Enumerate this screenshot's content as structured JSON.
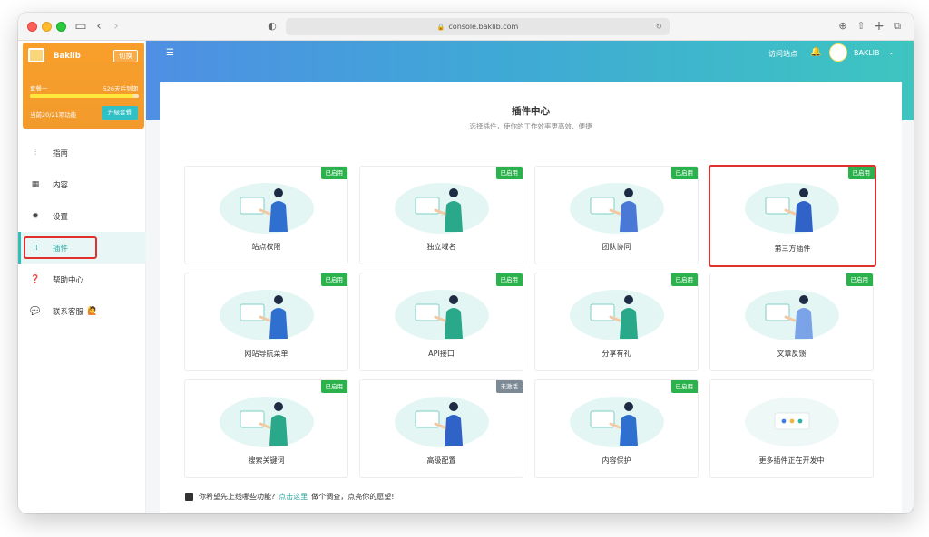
{
  "browser": {
    "url": "console.baklib.com"
  },
  "sidebar": {
    "brand_name": "Baklib",
    "switch_label": "切换",
    "plan_name": "套餐一",
    "plan_expire": "526天后到期",
    "plan_progress_percent": 95,
    "plan_features": "当前20/21项功能",
    "upgrade_label": "升级套餐",
    "items": [
      {
        "icon": "sliders-icon",
        "label": "指南"
      },
      {
        "icon": "grid-icon",
        "label": "内容"
      },
      {
        "icon": "gear-icon",
        "label": "设置"
      },
      {
        "icon": "dots-grid-icon",
        "label": "插件"
      },
      {
        "icon": "help-icon",
        "label": "帮助中心"
      },
      {
        "icon": "chat-icon",
        "label": "联系客服"
      }
    ]
  },
  "header": {
    "visit_site": "访问站点",
    "user_name": "BAKLIB"
  },
  "main": {
    "title": "插件中心",
    "subtitle": "选择插件，使你的工作效率更高效、便捷",
    "plugins": [
      {
        "name": "站点权限",
        "status": "已启用",
        "state": "on"
      },
      {
        "name": "独立域名",
        "status": "已启用",
        "state": "on"
      },
      {
        "name": "团队协同",
        "status": "已启用",
        "state": "on"
      },
      {
        "name": "第三方插件",
        "status": "已启用",
        "state": "on"
      },
      {
        "name": "网站导航菜单",
        "status": "已启用",
        "state": "on"
      },
      {
        "name": "API接口",
        "status": "已启用",
        "state": "on"
      },
      {
        "name": "分享有礼",
        "status": "已启用",
        "state": "on"
      },
      {
        "name": "文章反馈",
        "status": "已启用",
        "state": "on"
      },
      {
        "name": "搜索关键词",
        "status": "已启用",
        "state": "on"
      },
      {
        "name": "高级配置",
        "status": "未激活",
        "state": "off"
      },
      {
        "name": "内容保护",
        "status": "已启用",
        "state": "on"
      },
      {
        "name": "更多插件正在开发中",
        "status": "",
        "state": "none"
      }
    ],
    "footer_prefix": "你希望先上线哪些功能?",
    "footer_link": "点击这里",
    "footer_suffix": "做个调查，点亮你的愿望!"
  },
  "colors": {
    "accent": "#2cc0b6",
    "brand_orange": "#f29a2c",
    "enabled_badge": "#2bb24c",
    "inactive_badge": "#7d8a96",
    "highlight_red": "#e0302e"
  }
}
